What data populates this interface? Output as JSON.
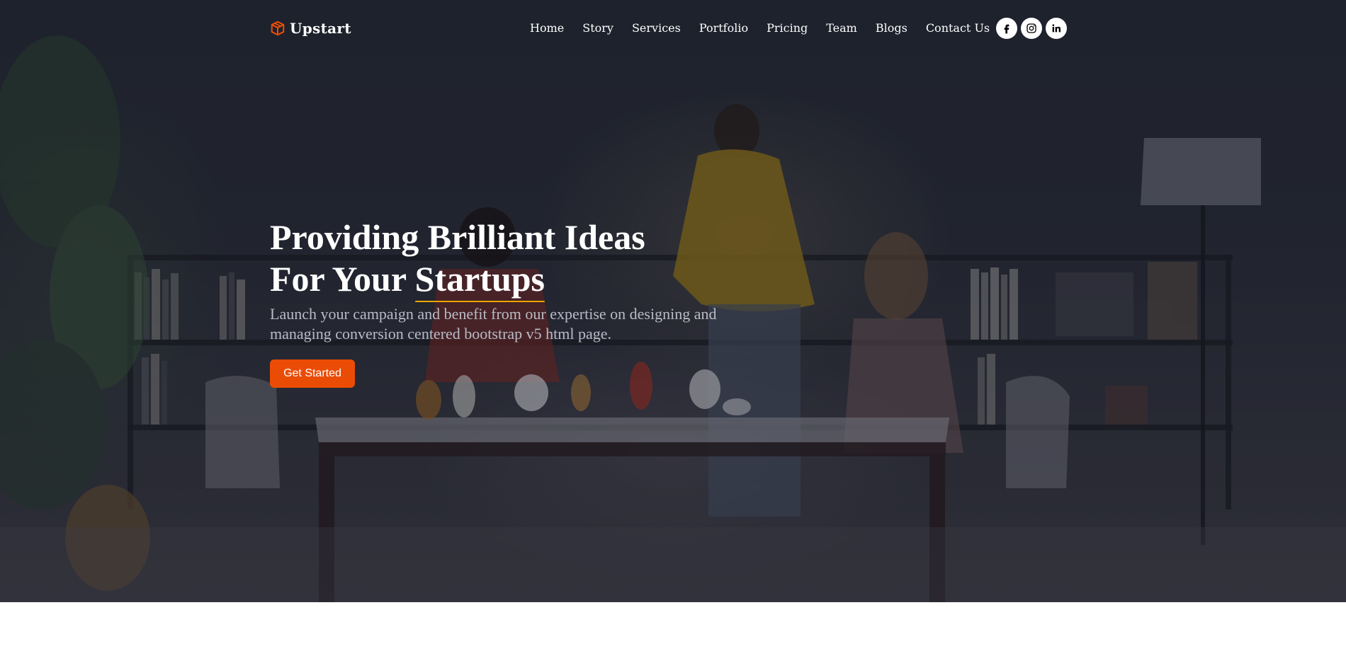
{
  "brand": {
    "name": "Upstart",
    "icon": "package-box-icon",
    "accent": "#ea4c06"
  },
  "nav": {
    "items": [
      "Home",
      "Story",
      "Services",
      "Portfolio",
      "Pricing",
      "Team",
      "Blogs",
      "Contact Us"
    ]
  },
  "social": [
    {
      "icon": "facebook-icon"
    },
    {
      "icon": "instagram-icon"
    },
    {
      "icon": "linkedin-icon"
    }
  ],
  "hero": {
    "title_line1": "Providing Brilliant Ideas",
    "title_line2_prefix": "For Your ",
    "title_line2_highlight": "Startups",
    "subtitle": "Launch your campaign and benefit from our expertise on designing and managing conversion centered bootstrap v5 html page.",
    "cta_label": "Get Started",
    "highlight_color": "#f0a500"
  }
}
